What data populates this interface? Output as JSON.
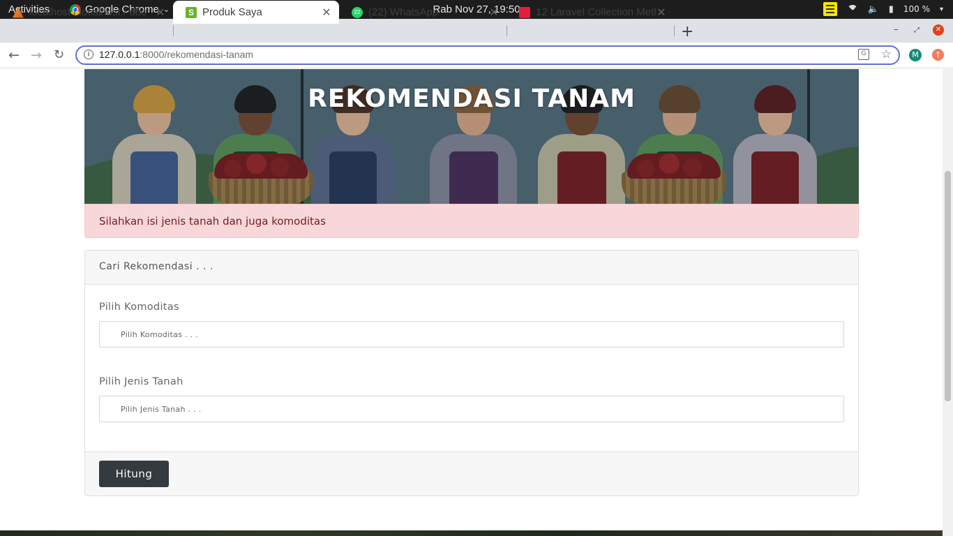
{
  "system": {
    "activities": "Activities",
    "app_name": "Google Chrome",
    "clock": "Rab Nov 27, 19:50",
    "battery": "100 %"
  },
  "browser": {
    "tabs": [
      {
        "title": "localhost / localhost / dbc",
        "icon": "phpmyadmin-icon"
      },
      {
        "title": "Produk Saya",
        "icon": "s-logo-icon"
      },
      {
        "title": "(22) WhatsApp",
        "icon": "whatsapp-icon",
        "badge": "22"
      },
      {
        "title": "12 Laravel Collection Meth",
        "icon": "laravel-icon"
      }
    ],
    "url_host": "127.0.0.1",
    "url_rest": ":8000/rekomendasi-tanam",
    "profile_initial": "M"
  },
  "page": {
    "banner_title": "REKOMENDASI TANAM",
    "alert": "Silahkan isi jenis tanah dan juga komoditas",
    "card_header": "Cari Rekomendasi . . .",
    "komoditas_label": "Pilih Komoditas",
    "komoditas_placeholder": "Pilih Komoditas . . .",
    "tanah_label": "Pilih Jenis Tanah",
    "tanah_placeholder": "Pilih Jenis Tanah . . .",
    "submit_label": "Hitung"
  },
  "colors": {
    "alert_bg": "#f8d7da",
    "alert_text": "#721c24",
    "button_bg": "#343a40",
    "omnibox_focus": "#5f6fd6"
  }
}
